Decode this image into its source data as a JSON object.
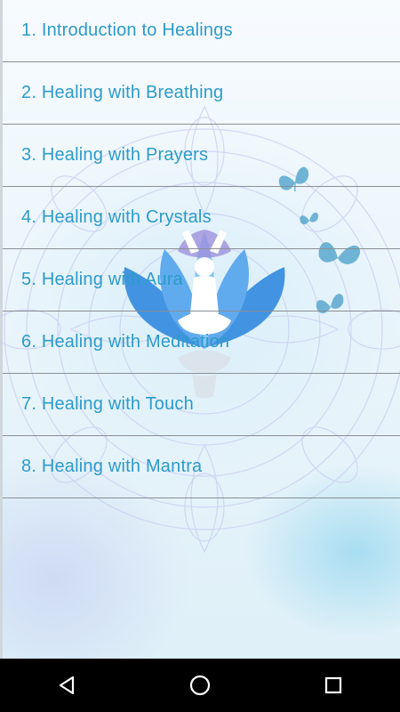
{
  "menu": {
    "items": [
      {
        "label": "1. Introduction to Healings"
      },
      {
        "label": "2. Healing with Breathing"
      },
      {
        "label": "3. Healing with Prayers"
      },
      {
        "label": "4. Healing with Crystals"
      },
      {
        "label": "5. Healing with Aura"
      },
      {
        "label": "6. Healing with Meditation"
      },
      {
        "label": "7. Healing with Touch"
      },
      {
        "label": "8. Healing with Mantra"
      }
    ]
  },
  "background": {
    "illustration": "meditating-figure-on-lotus",
    "decorations": [
      "mandala-pattern",
      "butterfly-icons"
    ],
    "colors": {
      "lotus": "#3a8fe0",
      "lotus_light": "#7fc4f5",
      "figure": "#ffffff",
      "butterfly": "#5aa9cf"
    }
  },
  "nav_bar": {
    "back_icon": "back-triangle-icon",
    "home_icon": "home-circle-icon",
    "recents_icon": "recents-square-icon"
  },
  "colors": {
    "item_text": "#2d9bc9",
    "divider": "#8a8f94",
    "nav_bg": "#000000"
  }
}
